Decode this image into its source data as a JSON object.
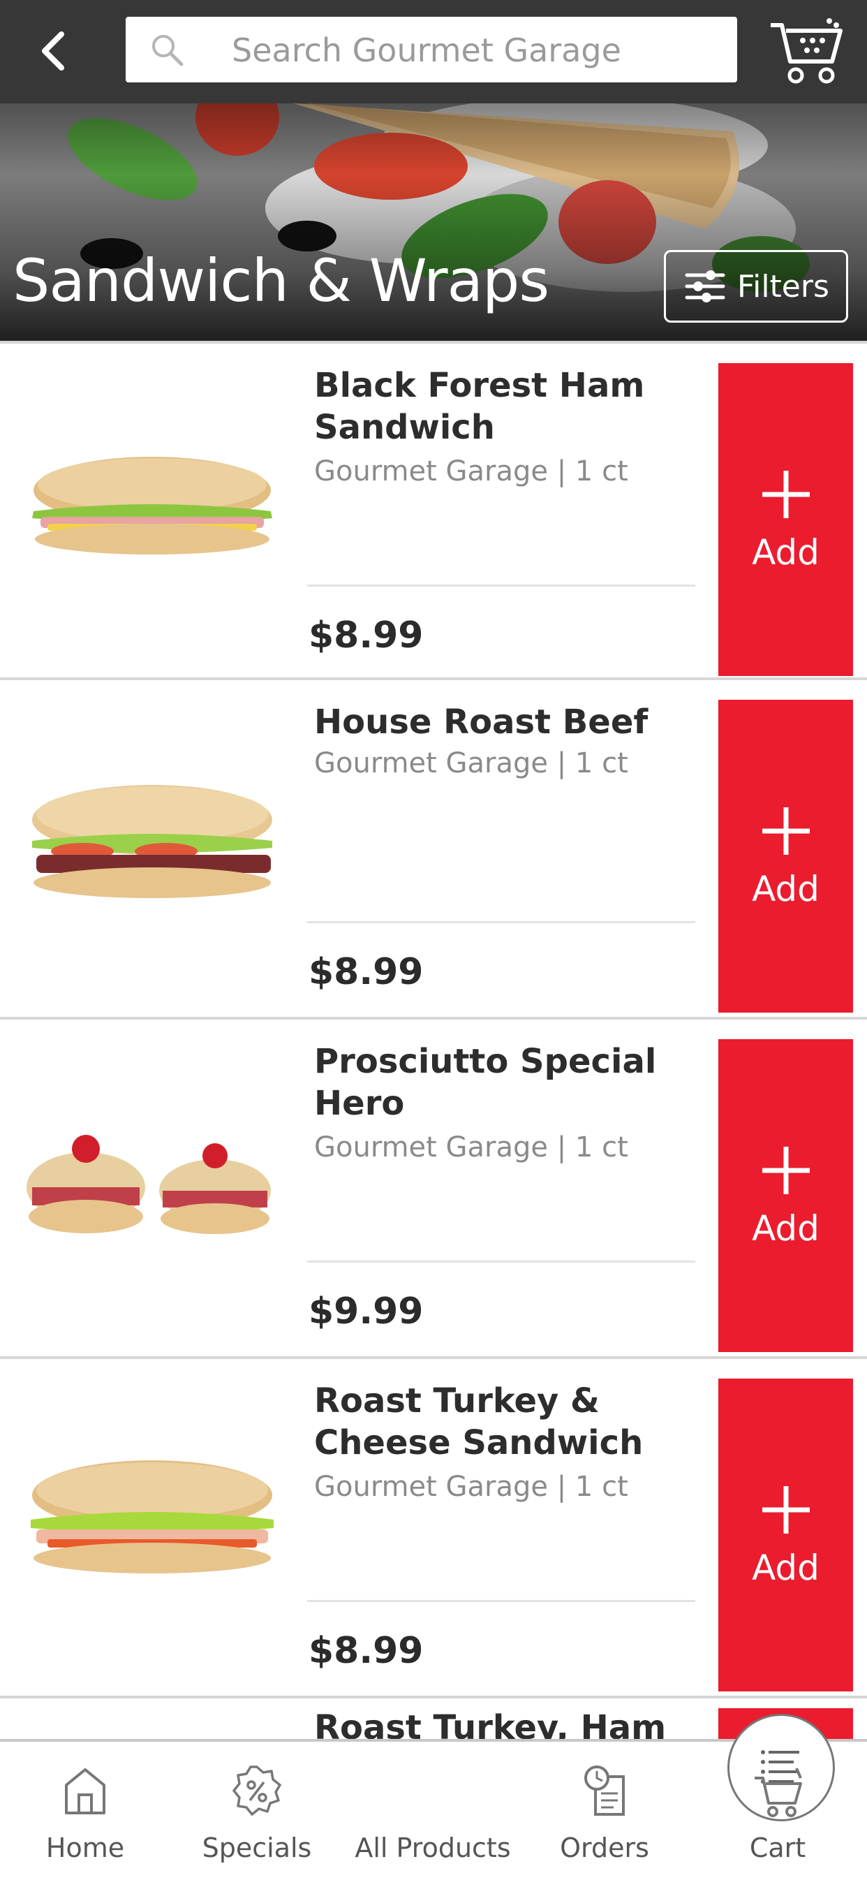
{
  "header": {
    "search_placeholder": "Search Gourmet Garage"
  },
  "hero": {
    "title": "Sandwich & Wraps",
    "filters_label": "Filters"
  },
  "products": [
    {
      "name_line1": "Black Forest Ham",
      "name_line2": "Sandwich",
      "brand": "Gourmet Garage | 1 ct",
      "price": "$8.99",
      "add_label": "Add"
    },
    {
      "name_line1": "House Roast Beef",
      "name_line2": "",
      "brand": "Gourmet Garage | 1 ct",
      "price": "$8.99",
      "add_label": "Add"
    },
    {
      "name_line1": "Prosciutto Special",
      "name_line2": "Hero",
      "brand": "Gourmet Garage | 1 ct",
      "price": "$9.99",
      "add_label": "Add"
    },
    {
      "name_line1": "Roast Turkey &",
      "name_line2": "Cheese Sandwich",
      "brand": "Gourmet Garage | 1 ct",
      "price": "$8.99",
      "add_label": "Add"
    },
    {
      "name_line1": "Roast Turkey, Ham &",
      "name_line2": "",
      "brand": "",
      "price": "",
      "add_label": ""
    }
  ],
  "bottom_nav": [
    {
      "label": "Home",
      "icon": "home-icon"
    },
    {
      "label": "Specials",
      "icon": "specials-badge-icon"
    },
    {
      "label": "All Products",
      "icon": "list-icon"
    },
    {
      "label": "Orders",
      "icon": "orders-clock-icon"
    },
    {
      "label": "Cart",
      "icon": "cart-icon"
    }
  ],
  "colors": {
    "header_bg": "#373737",
    "accent_red": "#ea1c2e",
    "divider": "#d6d6d6"
  }
}
